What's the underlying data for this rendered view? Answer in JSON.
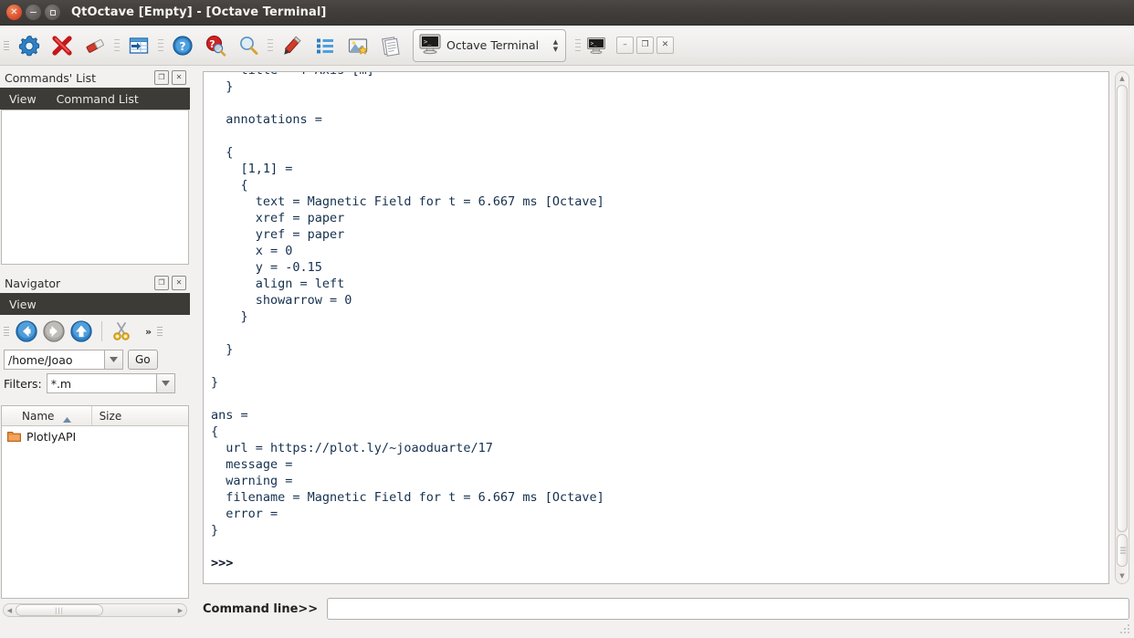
{
  "window": {
    "title": "QtOctave [Empty] - [Octave Terminal]",
    "controls": {
      "close": "close-button",
      "minimize": "minimize-button",
      "maximize": "maximize-button"
    }
  },
  "toolbar": {
    "buttons": [
      {
        "name": "settings-gear-icon",
        "tip": "Settings"
      },
      {
        "name": "close-red-x-icon",
        "tip": "Close"
      },
      {
        "name": "eraser-icon",
        "tip": "Clear"
      },
      {
        "name": "import-table-icon",
        "tip": "Import Data"
      },
      {
        "name": "help-question-icon",
        "tip": "Help"
      },
      {
        "name": "help-search-icon",
        "tip": "Search Help"
      },
      {
        "name": "magnifier-icon",
        "tip": "Find"
      },
      {
        "name": "pencil-edit-icon",
        "tip": "Editor"
      },
      {
        "name": "list-icon",
        "tip": "Variable List"
      },
      {
        "name": "image-star-icon",
        "tip": "Figures"
      },
      {
        "name": "documents-icon",
        "tip": "Documents"
      }
    ],
    "window_combo": {
      "label": "Octave Terminal",
      "icon": "terminal-icon"
    },
    "mdi_buttons": [
      {
        "name": "mdi-minimize-button",
        "glyph": "–"
      },
      {
        "name": "mdi-restore-button",
        "glyph": "❐"
      },
      {
        "name": "mdi-close-button",
        "glyph": "✕"
      }
    ],
    "mdi_icon": "terminal-small-icon"
  },
  "commands_list_dock": {
    "title": "Commands' List",
    "float_button": "❐",
    "close_button": "✕",
    "menu": [
      "View",
      "Command List"
    ]
  },
  "navigator_dock": {
    "title": "Navigator",
    "float_button": "❐",
    "close_button": "✕",
    "menu": [
      "View"
    ],
    "toolbar": [
      {
        "name": "back-arrow-icon",
        "state": "enabled"
      },
      {
        "name": "forward-arrow-icon",
        "state": "disabled"
      },
      {
        "name": "up-arrow-icon",
        "state": "enabled"
      },
      {
        "name": "scissors-cut-icon",
        "state": "enabled"
      }
    ],
    "overflow_label": "»",
    "path_value": "/home/Joao",
    "go_label": "Go",
    "filters_label": "Filters:",
    "filters_value": "*.m",
    "columns": [
      "Name",
      "Size"
    ],
    "sort_indicator": "ascending",
    "rows": [
      {
        "icon": "folder-icon",
        "name": "PlotlyAPI",
        "size": ""
      }
    ]
  },
  "terminal": {
    "clipped_top_line": "    title = Y Axis [m]",
    "lines": [
      "  }",
      "",
      "  annotations =",
      "",
      "  {",
      "    [1,1] =",
      "    {",
      "      text = Magnetic Field for t = 6.667 ms [Octave]",
      "      xref = paper",
      "      yref = paper",
      "      x = 0",
      "      y = -0.15",
      "      align = left",
      "      showarrow = 0",
      "    }",
      "",
      "  }",
      "",
      "}",
      "",
      "ans =",
      "{",
      "  url = https://plot.ly/~joaoduarte/17",
      "  message =",
      "  warning =",
      "  filename = Magnetic Field for t = 6.667 ms [Octave]",
      "  error =",
      "}",
      ""
    ],
    "prompt": ">>>"
  },
  "command_line": {
    "label": "Command line>>",
    "value": "",
    "placeholder": ""
  },
  "colors": {
    "titlebar": "#403d3a",
    "menubar": "#3c3b37",
    "chrome": "#f2f1f0",
    "terminal_text": "#14304f",
    "close_button": "#d8472a"
  }
}
